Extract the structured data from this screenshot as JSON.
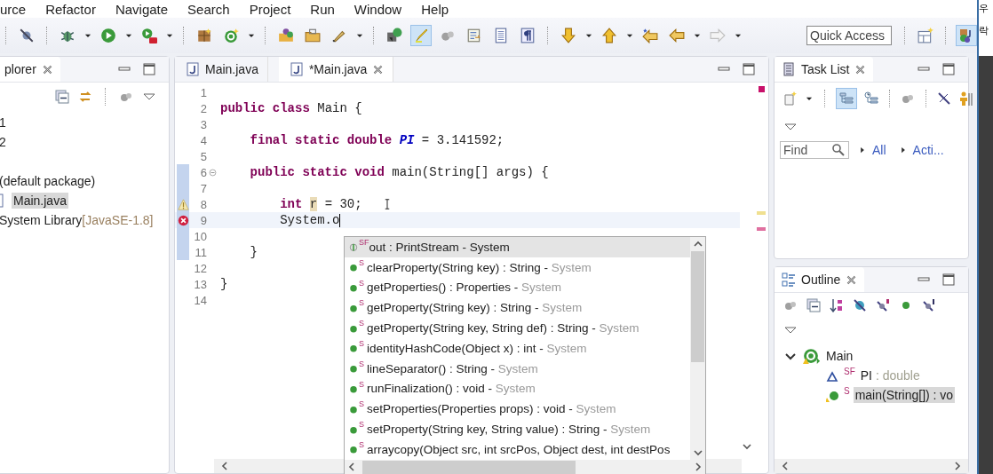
{
  "menu": [
    "urce",
    "Refactor",
    "Navigate",
    "Search",
    "Project",
    "Run",
    "Window",
    "Help"
  ],
  "toolbar": {
    "toggle": {
      "selected": true
    },
    "quick_access": {
      "placeholder": "Quick Access"
    },
    "perspective": {
      "selected": true
    }
  },
  "side_text": [
    "우",
    "락"
  ],
  "explorer": {
    "tab": "plorer",
    "items": [
      {
        "label": "1",
        "selected": false
      },
      {
        "label": "2",
        "selected": false
      },
      {
        "label": "(default package)",
        "selected": false
      },
      {
        "label": "Main.java",
        "selected": true
      },
      {
        "label": "System Library",
        "detail": "[JavaSE-1.8]",
        "selected": false
      }
    ]
  },
  "editor": {
    "tabs": [
      {
        "label": "Main.java",
        "selected": false
      },
      {
        "label": "*Main.java",
        "selected": true
      }
    ],
    "lines": [
      {
        "number": "1"
      },
      {
        "number": "2",
        "tokens": [
          {
            "text": "public class",
            "kind": "keyword"
          },
          {
            "text": " Main {",
            "kind": "plain"
          }
        ]
      },
      {
        "number": "3"
      },
      {
        "number": "4",
        "tokens": [
          {
            "text": "    final static double ",
            "kind": "keyword"
          },
          {
            "text": "PI",
            "kind": "constant"
          },
          {
            "text": " = 3.141592;",
            "kind": "plain"
          }
        ]
      },
      {
        "number": "5"
      },
      {
        "number": "6",
        "fold": true,
        "changed": true,
        "tokens": [
          {
            "text": "    public static void",
            "kind": "keyword"
          },
          {
            "text": " main(String[] args) {",
            "kind": "plain"
          }
        ]
      },
      {
        "number": "7",
        "changed": true
      },
      {
        "number": "8",
        "changed": true,
        "warning": true,
        "tokens": [
          {
            "text": "        int ",
            "kind": "keyword"
          },
          {
            "text": "r",
            "kind": "occurrence"
          },
          {
            "text": " = 30;",
            "kind": "plain"
          }
        ]
      },
      {
        "number": "9",
        "changed": true,
        "error": true,
        "current": true,
        "tokens": [
          {
            "text": "        System.o",
            "kind": "plain"
          }
        ]
      },
      {
        "number": "10",
        "changed": true
      },
      {
        "number": "11",
        "changed": true,
        "tokens": [
          {
            "text": "    }",
            "kind": "plain"
          }
        ]
      },
      {
        "number": "12"
      },
      {
        "number": "13",
        "tokens": [
          {
            "text": "}",
            "kind": "plain"
          }
        ]
      },
      {
        "number": "14"
      }
    ]
  },
  "completion": {
    "items": [
      {
        "kind": "field",
        "modifiers": "SF",
        "text": "out : PrintStream -",
        "source": "System",
        "selected": true
      },
      {
        "kind": "method",
        "modifiers": "S",
        "text": "clearProperty(String key) : String -",
        "source": "System",
        "selected": false
      },
      {
        "kind": "method",
        "modifiers": "S",
        "text": "getProperties() : Properties -",
        "source": "System",
        "selected": false
      },
      {
        "kind": "method",
        "modifiers": "S",
        "text": "getProperty(String key) : String -",
        "source": "System",
        "selected": false
      },
      {
        "kind": "method",
        "modifiers": "S",
        "text": "getProperty(String key, String def) : String -",
        "source": "System",
        "selected": false
      },
      {
        "kind": "method",
        "modifiers": "S",
        "text": "identityHashCode(Object x) : int -",
        "source": "System",
        "selected": false
      },
      {
        "kind": "method",
        "modifiers": "S",
        "text": "lineSeparator() : String -",
        "source": "System",
        "selected": false
      },
      {
        "kind": "method",
        "modifiers": "S",
        "text": "runFinalization() : void -",
        "source": "System",
        "selected": false
      },
      {
        "kind": "method",
        "modifiers": "S",
        "text": "setProperties(Properties props) : void -",
        "source": "System",
        "selected": false
      },
      {
        "kind": "method",
        "modifiers": "S",
        "text": "setProperty(String key, String value) : String -",
        "source": "System",
        "selected": false
      },
      {
        "kind": "method",
        "modifiers": "S",
        "text": "arraycopy(Object src, int srcPos, Object dest, int destPos",
        "selected": false
      }
    ]
  },
  "task_list": {
    "tab": "Task List",
    "toggle": {
      "selected": true
    },
    "find": {
      "placeholder": "Find"
    },
    "filters": [
      "All",
      "Acti..."
    ]
  },
  "outline": {
    "tab": "Outline",
    "tree": [
      {
        "label": "Main",
        "expanded": true,
        "selected": false,
        "children": [
          {
            "label": "PI",
            "modifiers": "SF",
            "type": " : double",
            "selected": false
          },
          {
            "label": "main(String[]) : vo",
            "modifiers": "S",
            "selected": true
          }
        ]
      }
    ]
  }
}
